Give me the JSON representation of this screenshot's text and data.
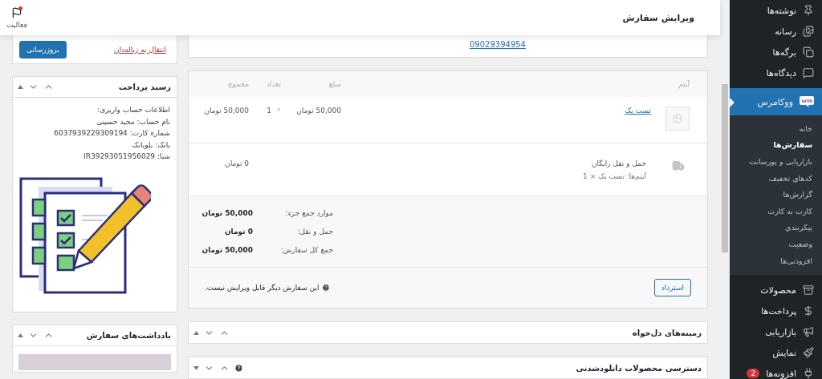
{
  "header": {
    "title": "ویرایش سفارش",
    "activity": "فعالیت",
    "activity_alert": true
  },
  "sidebar": {
    "items": [
      {
        "label": "نوشته‌ها",
        "selected": false
      },
      {
        "label": "رسانه",
        "selected": false
      },
      {
        "label": "برگه‌ها",
        "selected": false
      },
      {
        "label": "دیدگاه‌ها",
        "selected": false
      },
      {
        "label": "ووکامرس",
        "selected": true,
        "children": [
          {
            "label": "خانه",
            "selected": false
          },
          {
            "label": "سفارش‌ها",
            "selected": true
          },
          {
            "label": "بازاریابی و پورسانت",
            "selected": false
          },
          {
            "label": "کدهای تخفیف",
            "selected": false
          },
          {
            "label": "گزارش‌ها",
            "selected": false
          },
          {
            "label": "کارت به کارت",
            "selected": false
          },
          {
            "label": "پیکربندی",
            "selected": false
          },
          {
            "label": "وضعیت",
            "selected": false
          },
          {
            "label": "افزودنی‌ها",
            "selected": false
          }
        ]
      },
      {
        "label": "محصولات",
        "selected": false
      },
      {
        "label": "پرداخت‌ها",
        "selected": false
      },
      {
        "label": "بازاریابی",
        "selected": false
      },
      {
        "label": "نمایش",
        "selected": false
      },
      {
        "label": "افزونه‌ها",
        "selected": false,
        "badge": "2"
      }
    ]
  },
  "customer": {
    "phone": "09029394954"
  },
  "items_table": {
    "columns": [
      "آیتم",
      "مبلغ",
      "تعداد",
      "مجموع"
    ],
    "rows": [
      {
        "name": "تست یک",
        "price": "50,000 تومان",
        "times": "×",
        "qty": "1",
        "total": "50,000 تومان"
      }
    ],
    "shipping": {
      "name": "حمل و نقل رایگان",
      "meta": "آیتم‌ها: تست یک × 1",
      "total": "0 تومان"
    },
    "totals": [
      {
        "label": "موارد جمع جزء:",
        "value": "50,000 تومان"
      },
      {
        "label": "حمل و نقل:",
        "value": "0 تومان"
      },
      {
        "label": "جمع کل سفارش:",
        "value": "50,000 تومان"
      }
    ],
    "refund_button": "استرداد",
    "note": "این سفارش دیگر قابل ویرایش نیست."
  },
  "panels": [
    {
      "title": "زمینه‌های دل‌خواه",
      "help": false
    },
    {
      "title": "دسترسی محصولات دانلودشدنی",
      "help": true
    }
  ],
  "actions": {
    "update_button": "بروزرسانی",
    "trash_link": "انتقال به زباله‌دان"
  },
  "receipt": {
    "title": "رسید پرداخت",
    "lines": [
      "اطلاعات حساب واریزی:",
      "نام حساب: مجید حسینی",
      "شماره کارت: 6037939229309194",
      "بانک: بلوبانک",
      "شبا: IR39293051956029"
    ]
  },
  "notes": {
    "title": "یادداشت‌های سفارش"
  }
}
